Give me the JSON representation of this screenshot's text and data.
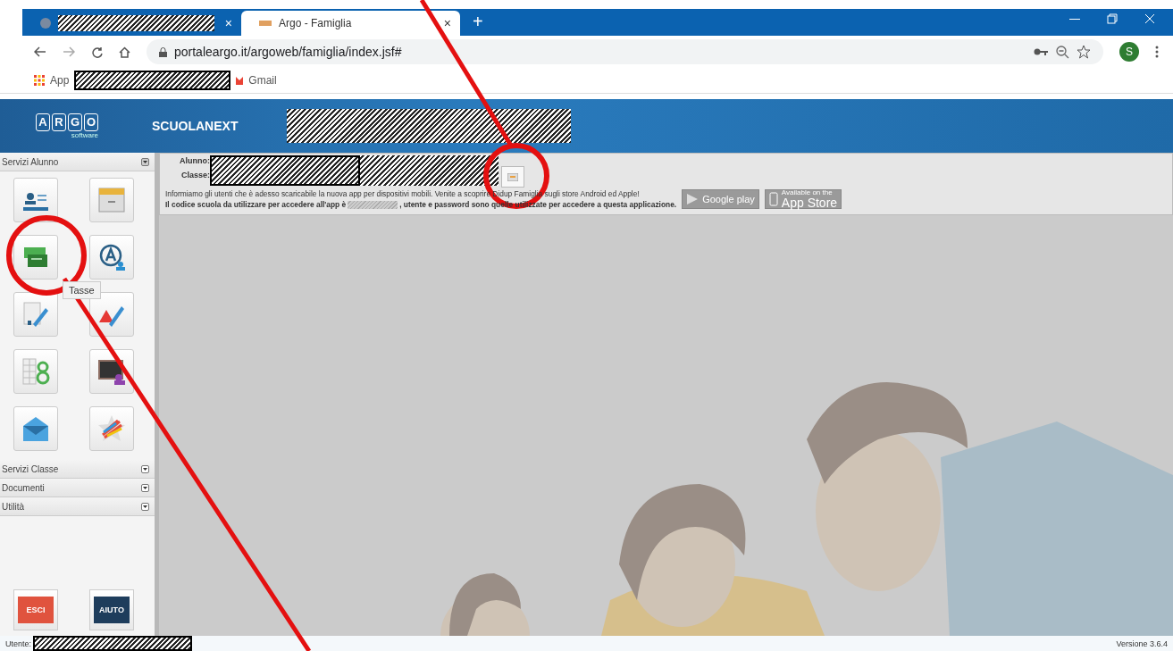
{
  "browser": {
    "tabs": [
      {
        "kind": "redacted",
        "selected": false,
        "close": "×"
      },
      {
        "kind": "page",
        "title": "Argo - Famiglia",
        "selected": true,
        "close": "×"
      }
    ],
    "new_tab": "+",
    "address": "portaleargo.it/argoweb/famiglia/index.jsf#",
    "profile_initial": "S",
    "bookmarks": [
      {
        "kind": "apps",
        "label": "App"
      },
      {
        "kind": "redacted"
      },
      {
        "kind": "gmail",
        "label": "Gmail"
      }
    ]
  },
  "header": {
    "logo_letters": [
      "A",
      "R",
      "G",
      "O"
    ],
    "logo_sub": "software",
    "product": "SCUOLANEXT"
  },
  "sidebar": {
    "sections": [
      {
        "title": "Servizi Alunno",
        "expanded": true,
        "tiles": [
          {
            "kind": "card"
          },
          {
            "kind": "drawer"
          },
          {
            "kind": "money"
          },
          {
            "kind": "person"
          },
          {
            "kind": "grade"
          },
          {
            "kind": "warning"
          },
          {
            "kind": "register"
          },
          {
            "kind": "board"
          },
          {
            "kind": "mail"
          },
          {
            "kind": "star"
          }
        ]
      },
      {
        "title": "Servizi Classe",
        "expanded": false
      },
      {
        "title": "Documenti",
        "expanded": false
      },
      {
        "title": "Utilità",
        "expanded": false
      }
    ],
    "tooltip": "Tasse",
    "actions": [
      {
        "kind": "exit",
        "label": "ESCI"
      },
      {
        "kind": "help",
        "label": "AIUTO"
      }
    ]
  },
  "student": {
    "labels": [
      "Alunno:",
      "Classe:"
    ],
    "info": "Informiamo gli utenti che è adesso scaricabile la nuova app per dispositivi mobili. Venite a scoprire Didup Famiglia sugli store Android ed Apple!",
    "code_before": "Il codice scuola da utilizzare per accedere all'app è",
    "code_after": ", utente e password sono quelle utilizzate per accedere a questa applicazione.",
    "stores": [
      {
        "kind": "google",
        "label": "Google play"
      },
      {
        "kind": "apple",
        "caption": "Available on the",
        "label": "App Store"
      }
    ]
  },
  "footer": {
    "user_label": "Utente:",
    "version": "Versione 3.6.4"
  }
}
